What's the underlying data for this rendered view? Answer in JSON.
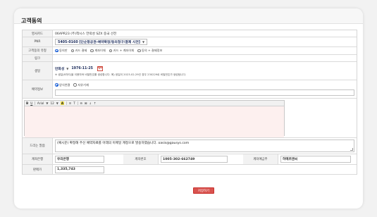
{
  "title": "고객동의",
  "rows": {
    "project_card": {
      "label": "영사카드",
      "value": "06APR23 (주)착시스 언락성 SZX 중국 선전"
    },
    "pnr": {
      "label": "PNR",
      "value": "5405-0160 [단순항공권-예약확정/동의청구/결제 시전]"
    },
    "payment_type": {
      "label": "고객동의 유형",
      "options": [
        "동의만",
        "카드 결제",
        "계좌이체",
        "카드 + 계좌이체",
        "동의 + 결제정보"
      ],
      "selected": 0
    },
    "link": {
      "label": "링크"
    },
    "birth": {
      "label": "생일",
      "type_value": "만화성",
      "date_value": "1976-11-25",
      "note": "※ 생일(8자리)을 이용하여 비밀번호를 생성합니다. 예) 생일이 2023-02-29인 경우 230229로 비밀번호가 생성됩니다."
    },
    "reservation": {
      "label": "예약정보",
      "options": [
        "양식연결",
        "자유기재"
      ],
      "selected": 0
    },
    "editor": {
      "toolbar": [
        "B",
        "U",
        "Arial",
        "12",
        "A",
        "≡",
        "T",
        "⊖",
        "⊠",
        "↓",
        "↑"
      ]
    },
    "message": {
      "label": "드리는 말씀",
      "value": "(예시문) 확정해 주신 예약자료를 아래의 이메일 계정으로 발송하였습니다. oasis@gausys.com"
    },
    "bank": {
      "label": "계좌은행",
      "value": "우리은행",
      "acct_label": "계좌번호",
      "acct_value": "1005-302-662749",
      "holder_label": "계좌예금주",
      "holder_value": "하메르엔씨"
    },
    "price": {
      "label": "판매가",
      "value": "1,335,743"
    }
  },
  "save_button": "저장하기"
}
